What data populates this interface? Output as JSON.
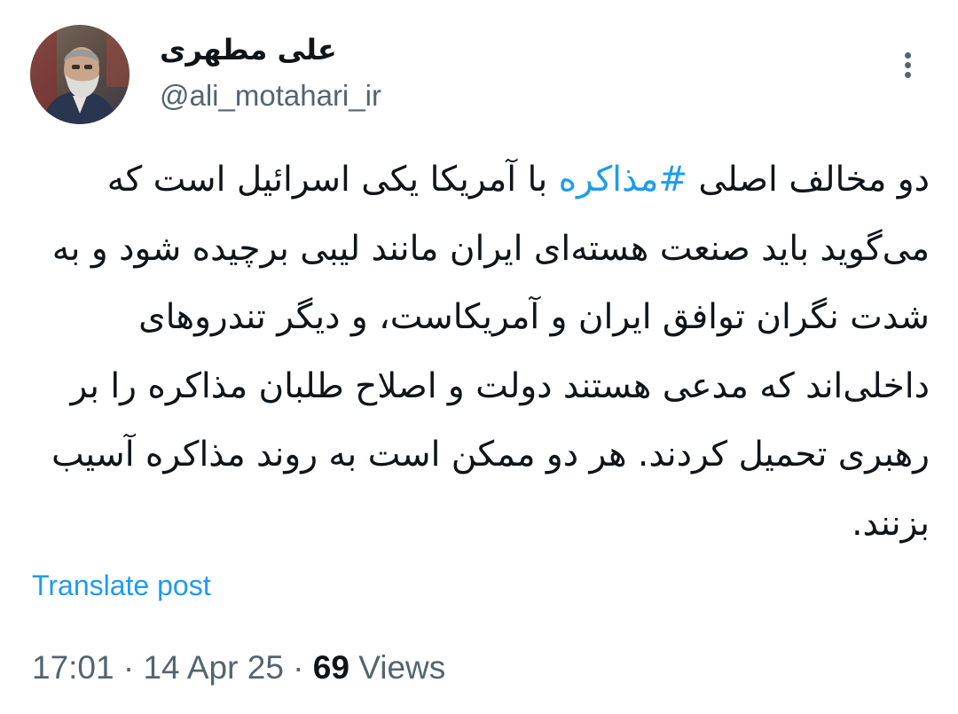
{
  "author": {
    "display_name": "علی مطهری",
    "handle": "@ali_motahari_ir"
  },
  "post": {
    "text_before_hashtag": "دو مخالف اصلی ",
    "hashtag": "#مذاکره",
    "text_after_hashtag": " با آمریکا یکی اسرائیل است که می‌گوید باید صنعت هسته‌ای ایران مانند لیبی برچیده شود و به شدت نگران توافق ایران و آمریکاست، و دیگر تندروهای داخلی‌اند که مدعی هستند دولت و اصلاح طلبان مذاکره را بر رهبری تحمیل کردند. هر دو ممکن است به روند مذاکره آسیب بزنند."
  },
  "translate_label": "Translate post",
  "meta": {
    "time": "17:01",
    "separator": "·",
    "date": "14 Apr 25",
    "views_count": "69",
    "views_label": "Views"
  },
  "icons": {
    "more": "more-vertical-icon",
    "avatar": "profile-photo"
  },
  "colors": {
    "accent": "#1d9bf0",
    "secondary_text": "#536471",
    "primary_text": "#0f1419"
  }
}
